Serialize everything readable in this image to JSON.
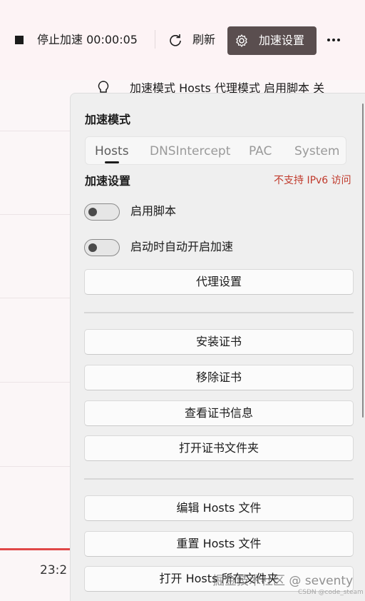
{
  "toolbar": {
    "stop_label": "停止加速 00:00:05",
    "refresh_label": "刷新",
    "settings_label": "加速设置"
  },
  "status_line": "加速模式  Hosts 代理模式  启用脚本  关",
  "background": {
    "time_label": "23:2"
  },
  "flyout": {
    "mode_title": "加速模式",
    "modes": [
      "Hosts",
      "DNSIntercept",
      "PAC",
      "System"
    ],
    "selected_mode": "Hosts",
    "settings_title": "加速设置",
    "ipv6_notice": "不支持 IPv6 访问",
    "toggles": [
      {
        "label": "启用脚本",
        "on": false
      },
      {
        "label": "启动时自动开启加速",
        "on": false
      }
    ],
    "proxy_settings": "代理设置",
    "cert_buttons": [
      "安装证书",
      "移除证书",
      "查看证书信息",
      "打开证书文件夹"
    ],
    "hosts_buttons": [
      "编辑 Hosts 文件",
      "重置 Hosts 文件",
      "打开 Hosts 所在文件夹"
    ]
  },
  "watermark": {
    "main": "掘金技术社区 @ seventy",
    "sub": "CSDN @code_steam"
  },
  "colors": {
    "settings_button_bg": "#5a4e4f",
    "ipv6_notice": "#c0392b",
    "chart_line": "#e04848"
  }
}
